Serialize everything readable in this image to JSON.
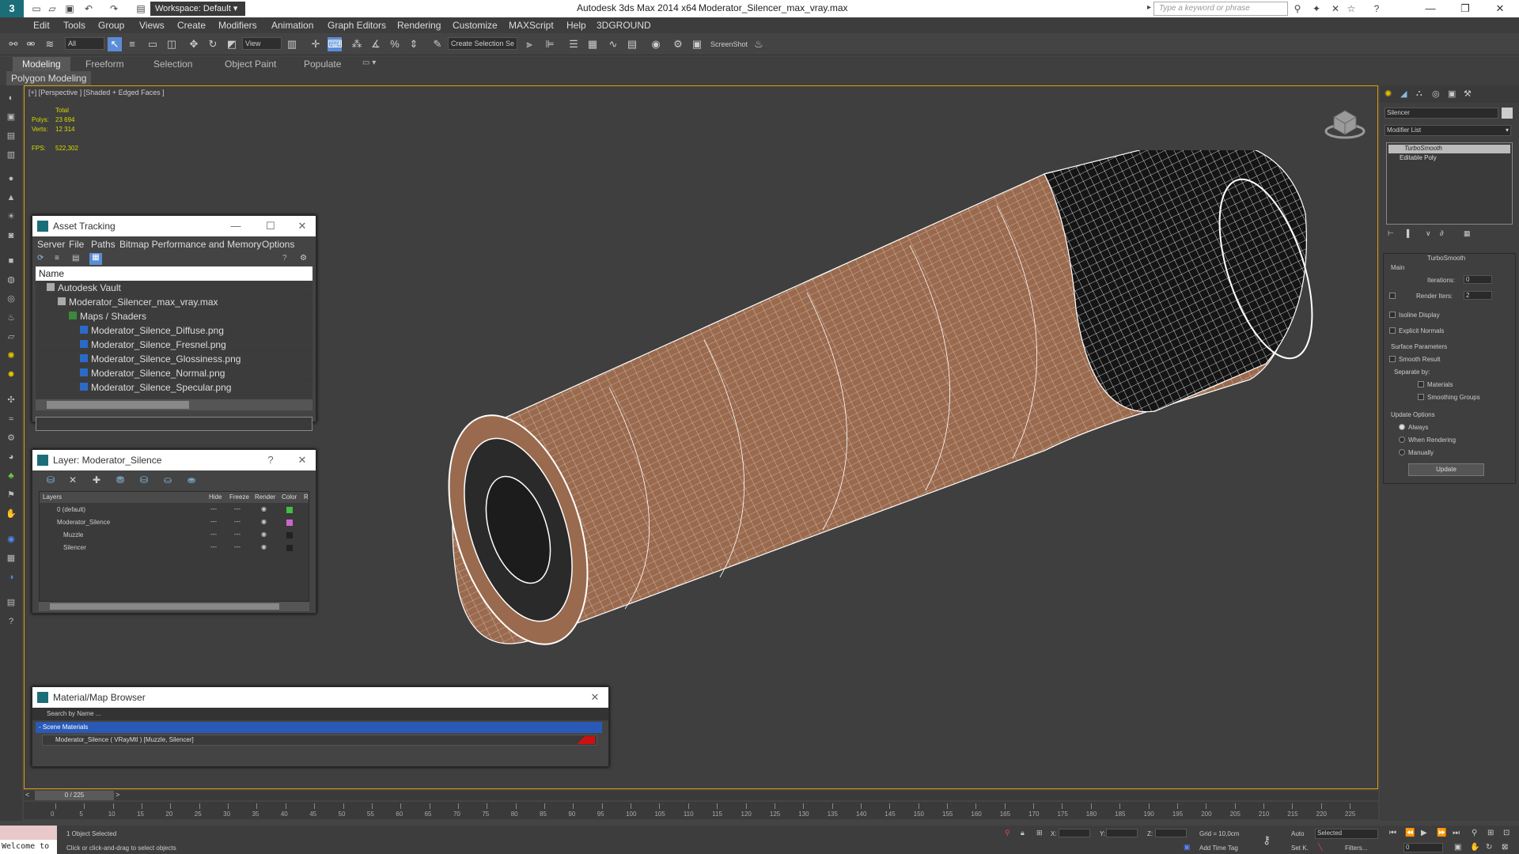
{
  "title_bar": {
    "logo": "3",
    "workspace": "Workspace: Default",
    "app_name": "Autodesk 3ds Max  2014 x64",
    "file_name": "Moderator_Silencer_max_vray.max",
    "search_placeholder": "Type a keyword or phrase"
  },
  "menu": [
    "Edit",
    "Tools",
    "Group",
    "Views",
    "Create",
    "Modifiers",
    "Animation",
    "Graph Editors",
    "Rendering",
    "Customize",
    "MAXScript",
    "Help",
    "3DGROUND"
  ],
  "toolbar": {
    "filter_select": "All",
    "ref_coord_select": "View",
    "named_selection": "Create Selection Se",
    "screenshot_label": "ScreenShot"
  },
  "ribbon": {
    "tabs": [
      "Modeling",
      "Freeform",
      "Selection",
      "Object Paint",
      "Populate"
    ],
    "active_tab": "Modeling",
    "sub_tab": "Polygon Modeling"
  },
  "viewport": {
    "label": "[+] [Perspective ] [Shaded + Edged Faces ]",
    "stats": {
      "total_label": "Total",
      "polys_label": "Polys:",
      "polys_value": "23 694",
      "verts_label": "Verts:",
      "verts_value": "12 314",
      "fps_label": "FPS:",
      "fps_value": "522,302"
    },
    "colors": {
      "body": "#9a6a4e",
      "wire": "#ffffff",
      "dark": "#1a1a1a"
    }
  },
  "asset_tracking": {
    "title": "Asset Tracking",
    "menus": [
      "Server",
      "File",
      "Paths",
      "Bitmap Performance and Memory",
      "Options"
    ],
    "column_name": "Name",
    "rows": [
      {
        "label": "Autodesk Vault",
        "indent": 1
      },
      {
        "label": "Moderator_Silencer_max_vray.max",
        "indent": 2
      },
      {
        "label": "Maps / Shaders",
        "indent": 3
      },
      {
        "label": "Moderator_Silence_Diffuse.png",
        "indent": 4
      },
      {
        "label": "Moderator_Silence_Fresnel.png",
        "indent": 4
      },
      {
        "label": "Moderator_Silence_Glossiness.png",
        "indent": 4
      },
      {
        "label": "Moderator_Silence_Normal.png",
        "indent": 4
      },
      {
        "label": "Moderator_Silence_Specular.png",
        "indent": 4
      }
    ]
  },
  "layer_window": {
    "title": "Layer: Moderator_Silence",
    "help": "?",
    "columns": [
      "Layers",
      "Hide",
      "Freeze",
      "Render",
      "Color",
      "R"
    ],
    "rows": [
      {
        "label": "0 (default)",
        "color": "#44bb44"
      },
      {
        "label": "Moderator_Silence",
        "color": "#cc66cc"
      },
      {
        "label": "Muzzle",
        "color": "#222222"
      },
      {
        "label": "Silencer",
        "color": "#222222"
      }
    ]
  },
  "material_browser": {
    "title": "Material/Map Browser",
    "search_placeholder": "Search by Name ...",
    "group_label": "- Scene Materials",
    "material": "Moderator_Silence  ( VRayMtl )  [Muzzle, Silencer]"
  },
  "command_panel": {
    "object_name": "Silencer",
    "modifier_list": "Modifier List",
    "stack": [
      "TurboSmooth",
      "Editable Poly"
    ],
    "rollout_title": "TurboSmooth",
    "main_label": "Main",
    "iterations_label": "Iterations:",
    "iterations_value": "0",
    "render_iters_label": "Render Iters:",
    "render_iters_value": "2",
    "isoline_label": "Isoline Display",
    "explicit_normals_label": "Explicit Normals",
    "surface_params_label": "Surface Parameters",
    "smooth_result_label": "Smooth Result",
    "separate_by_label": "Separate by:",
    "materials_label": "Materials",
    "smoothing_groups_label": "Smoothing Groups",
    "update_options_label": "Update Options",
    "always_label": "Always",
    "when_rendering_label": "When Rendering",
    "manually_label": "Manually",
    "update_button": "Update"
  },
  "timeline": {
    "frame_counter": "0 / 225",
    "ticks": [
      "0",
      "5",
      "10",
      "15",
      "20",
      "25",
      "30",
      "35",
      "40",
      "45",
      "50",
      "55",
      "60",
      "65",
      "70",
      "75",
      "80",
      "85",
      "90",
      "95",
      "100",
      "105",
      "110",
      "115",
      "120",
      "125",
      "130",
      "135",
      "140",
      "145",
      "150",
      "155",
      "160",
      "165",
      "170",
      "175",
      "180",
      "185",
      "190",
      "195",
      "200",
      "205",
      "210",
      "215",
      "220",
      "225"
    ]
  },
  "status": {
    "maxscript": "Welcome to",
    "selected_count": "1 Object Selected",
    "prompt": "Click or click-and-drag to select objects",
    "x_label": "X:",
    "y_label": "Y:",
    "z_label": "Z:",
    "grid": "Grid = 10,0cm",
    "add_time_tag": "Add Time Tag",
    "auto": "Auto",
    "set_key": "Set K.",
    "selected_select": "Selected",
    "filters": "Filters...",
    "frame_value": "0"
  }
}
